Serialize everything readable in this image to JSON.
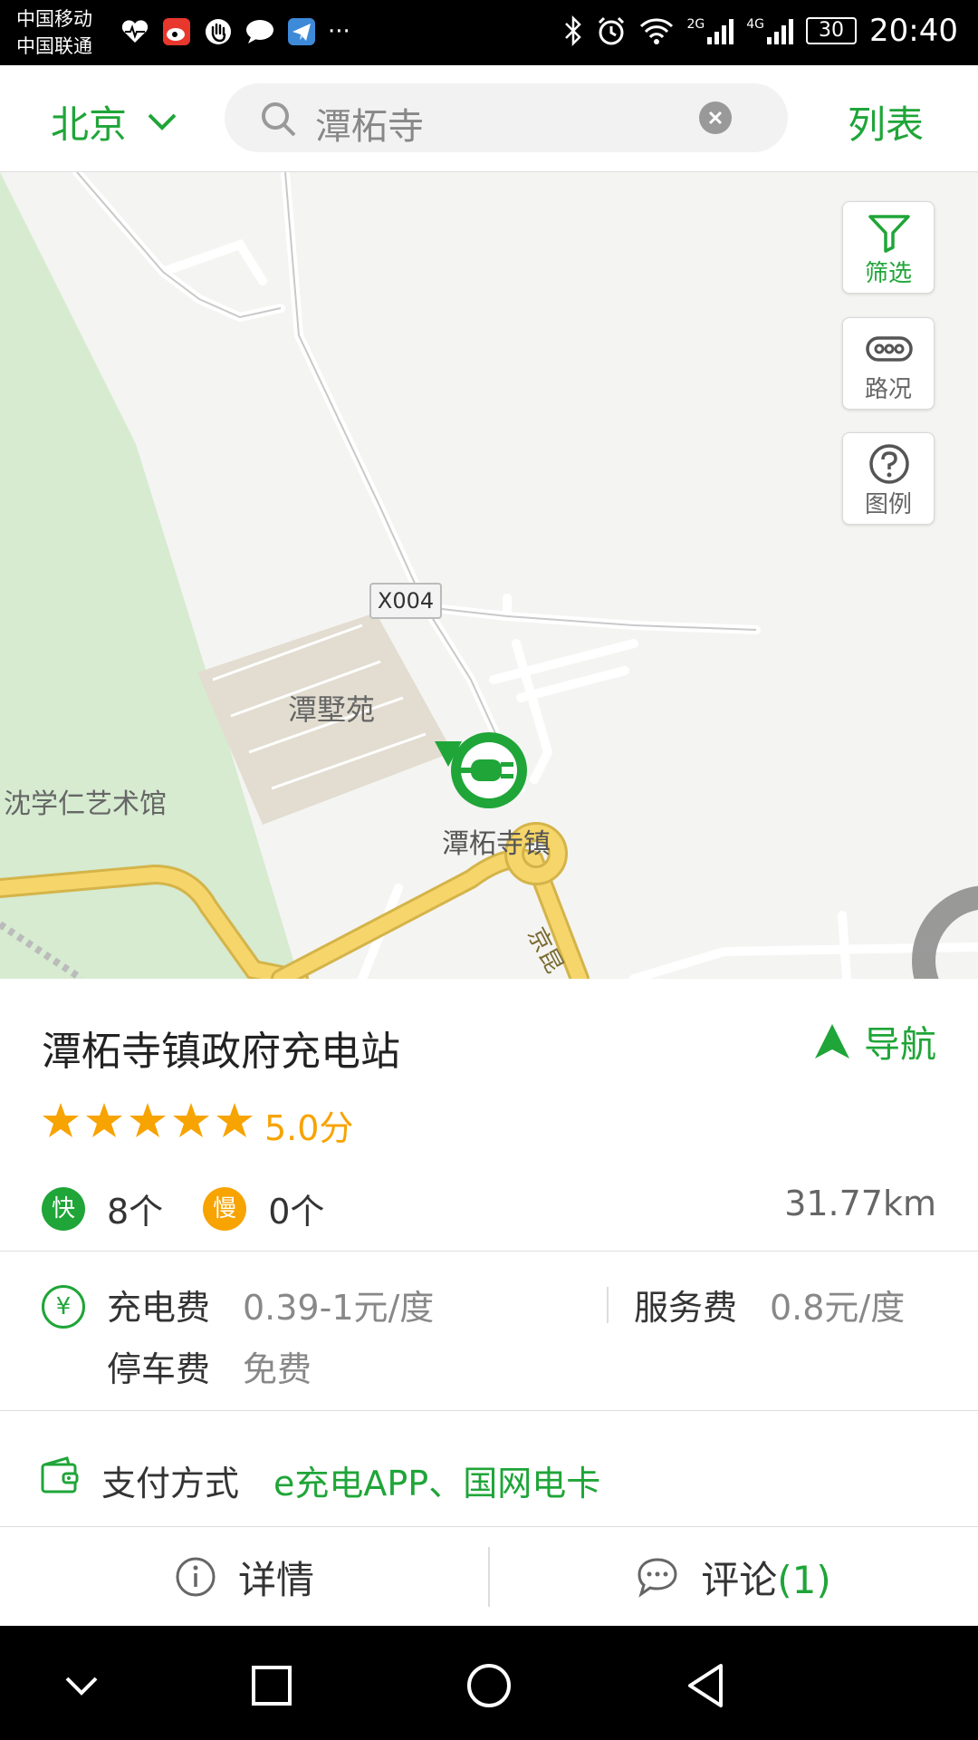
{
  "status_bar": {
    "carrier_1": "中国移动",
    "carrier_2": "中国联通",
    "overflow": "···",
    "net_2g": "2G",
    "net_4g": "4G",
    "battery": "30",
    "time": "20:40"
  },
  "header": {
    "city": "北京",
    "search_value": "潭柘寺",
    "list_label": "列表"
  },
  "map": {
    "buttons": {
      "filter": "筛选",
      "traffic": "路况",
      "legend": "图例"
    },
    "road_label": "X004",
    "places": {
      "estate": "潭墅苑",
      "museum": "沈学仁艺术馆",
      "station_pin": "潭柘寺镇",
      "road": "京昆"
    }
  },
  "station": {
    "name": "潭柘寺镇政府充电站",
    "nav_label": "导航",
    "rating": 5.0,
    "rating_text": "5.0分",
    "fast_badge": "快",
    "fast_count": "8个",
    "slow_badge": "慢",
    "slow_count": "0个",
    "distance": "31.77km",
    "charge_fee_icon": "¥",
    "charge_fee_label": "充电费",
    "charge_fee_value": "0.39-1元/度",
    "service_fee_label": "服务费",
    "service_fee_value": "0.8元/度",
    "parking_fee_label": "停车费",
    "parking_fee_value": "免费",
    "payment_label": "支付方式",
    "payment_value": "e充电APP、国网电卡"
  },
  "tabs": {
    "detail": "详情",
    "comment": "评论",
    "comment_count": "(1)"
  },
  "colors": {
    "accent": "#1fa538",
    "rating": "#f7a300",
    "map_bg": "#f4f4f2",
    "park": "#d6ebd0",
    "estate": "#e2ddd0",
    "highway": "#f6d66a"
  }
}
